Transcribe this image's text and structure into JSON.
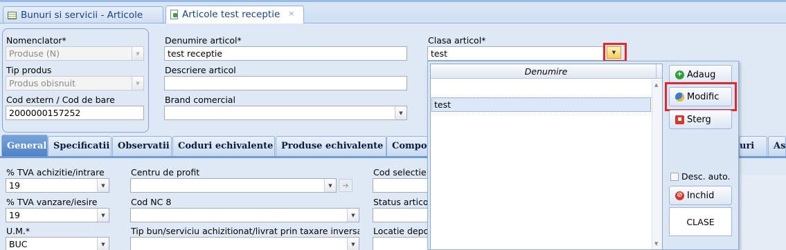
{
  "top_tabs": [
    {
      "label": "Bunuri si servicii - Articole",
      "active": false
    },
    {
      "label": "Articole test receptie",
      "active": true,
      "close": "×"
    }
  ],
  "header": {
    "nomenclator": {
      "label": "Nomenclator*",
      "value": "Produse (N)"
    },
    "tip_produs": {
      "label": "Tip produs",
      "value": "Produs obisnuit"
    },
    "cod_extern": {
      "label": "Cod extern / Cod de bare",
      "value": "2000000157252"
    },
    "denumire": {
      "label": "Denumire articol*",
      "value": "test receptie"
    },
    "descriere": {
      "label": "Descriere articol",
      "value": ""
    },
    "brand": {
      "label": "Brand comercial",
      "value": ""
    },
    "clasa": {
      "label": "Clasa articol*",
      "value": "test"
    }
  },
  "form_tabs": [
    "General",
    "Specificatii",
    "Observatii",
    "Coduri echivalente",
    "Produse echivalente",
    "Compon",
    "uri",
    "Asc"
  ],
  "general": {
    "tva_achizitie": {
      "label": "% TVA achizitie/intrare",
      "value": "19"
    },
    "tva_vanzare": {
      "label": "% TVA vanzare/iesire",
      "value": "19"
    },
    "um": {
      "label": "U.M.*",
      "value": "BUC"
    },
    "centru_profit": {
      "label": "Centru de profit",
      "value": ""
    },
    "cod_nc8": {
      "label": "Cod NC 8",
      "value": ""
    },
    "tip_bun": {
      "label": "Tip bun/serviciu achizitionat/livrat prin taxare inversa",
      "value": ""
    },
    "cod_selectie": {
      "label": "Cod selectie"
    },
    "status_articol": {
      "label": "Status artico"
    },
    "locatie_depozit": {
      "label": "Locatie depo"
    }
  },
  "dropdown": {
    "column_header": "Denumire",
    "rows": [
      "test"
    ],
    "buttons": {
      "adaug": "Adaug",
      "modific": "Modific",
      "sterg": "Sterg",
      "desc_auto": "Desc. auto.",
      "inchid": "Inchid",
      "clase": "CLASE"
    }
  },
  "colors": {
    "highlight": "#e4262d",
    "accent": "#15428b",
    "active_tab": "#4d83c9"
  }
}
